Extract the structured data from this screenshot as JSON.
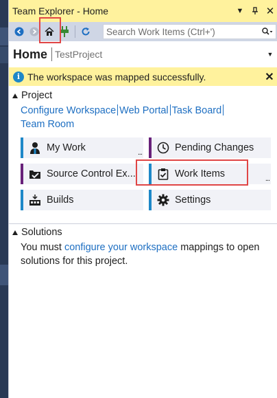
{
  "window": {
    "title": "Team Explorer - Home"
  },
  "toolbar": {
    "search_placeholder": "Search Work Items (Ctrl+')"
  },
  "header": {
    "page": "Home",
    "project": "TestProject"
  },
  "banner": {
    "message": "The workspace was mapped successfully."
  },
  "project_section": {
    "title": "Project",
    "links": [
      "Configure Workspace",
      "Web Portal",
      "Task Board",
      "Team Room"
    ],
    "tiles": [
      {
        "label": "My Work",
        "icon": "person-icon",
        "accent": "#1e88c8"
      },
      {
        "label": "Pending Changes",
        "icon": "clock-icon",
        "accent": "#68217a"
      },
      {
        "label": "Source Control Ex...",
        "icon": "folder-check-icon",
        "accent": "#68217a"
      },
      {
        "label": "Work Items",
        "icon": "clipboard-check-icon",
        "accent": "#1e88c8"
      },
      {
        "label": "Builds",
        "icon": "build-icon",
        "accent": "#1e88c8"
      },
      {
        "label": "Settings",
        "icon": "gear-icon",
        "accent": "#1e88c8"
      }
    ]
  },
  "solutions_section": {
    "title": "Solutions",
    "text_before": "You must ",
    "link": "configure your workspace",
    "text_after": " mappings to open solutions for this project."
  },
  "colors": {
    "title_bar": "#fff29d",
    "toolbar": "#cfd6e5",
    "link": "#1e6fc2",
    "highlight": "#e04545"
  }
}
